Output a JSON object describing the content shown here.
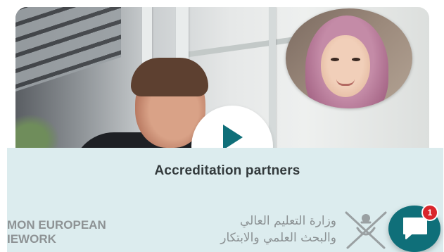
{
  "hero": {
    "video_thumbnail": "man-smiling-office",
    "portrait": "woman-in-hijab",
    "play_icon": "play-icon",
    "accent_color": "#0f6f79"
  },
  "partners": {
    "title": "Accreditation partners",
    "logos": {
      "eu_line1": "MON EUROPEAN",
      "eu_line2": "IEWORK",
      "ministry_line1": "وزارة التعليم العالي",
      "ministry_line2": "والبحث العلمي والابتكار",
      "emblem": "oman-emblem-icon"
    },
    "background": "#dcecee"
  },
  "chat": {
    "icon": "chat-bubble-icon",
    "badge_count": "1",
    "badge_color": "#d9262c"
  }
}
